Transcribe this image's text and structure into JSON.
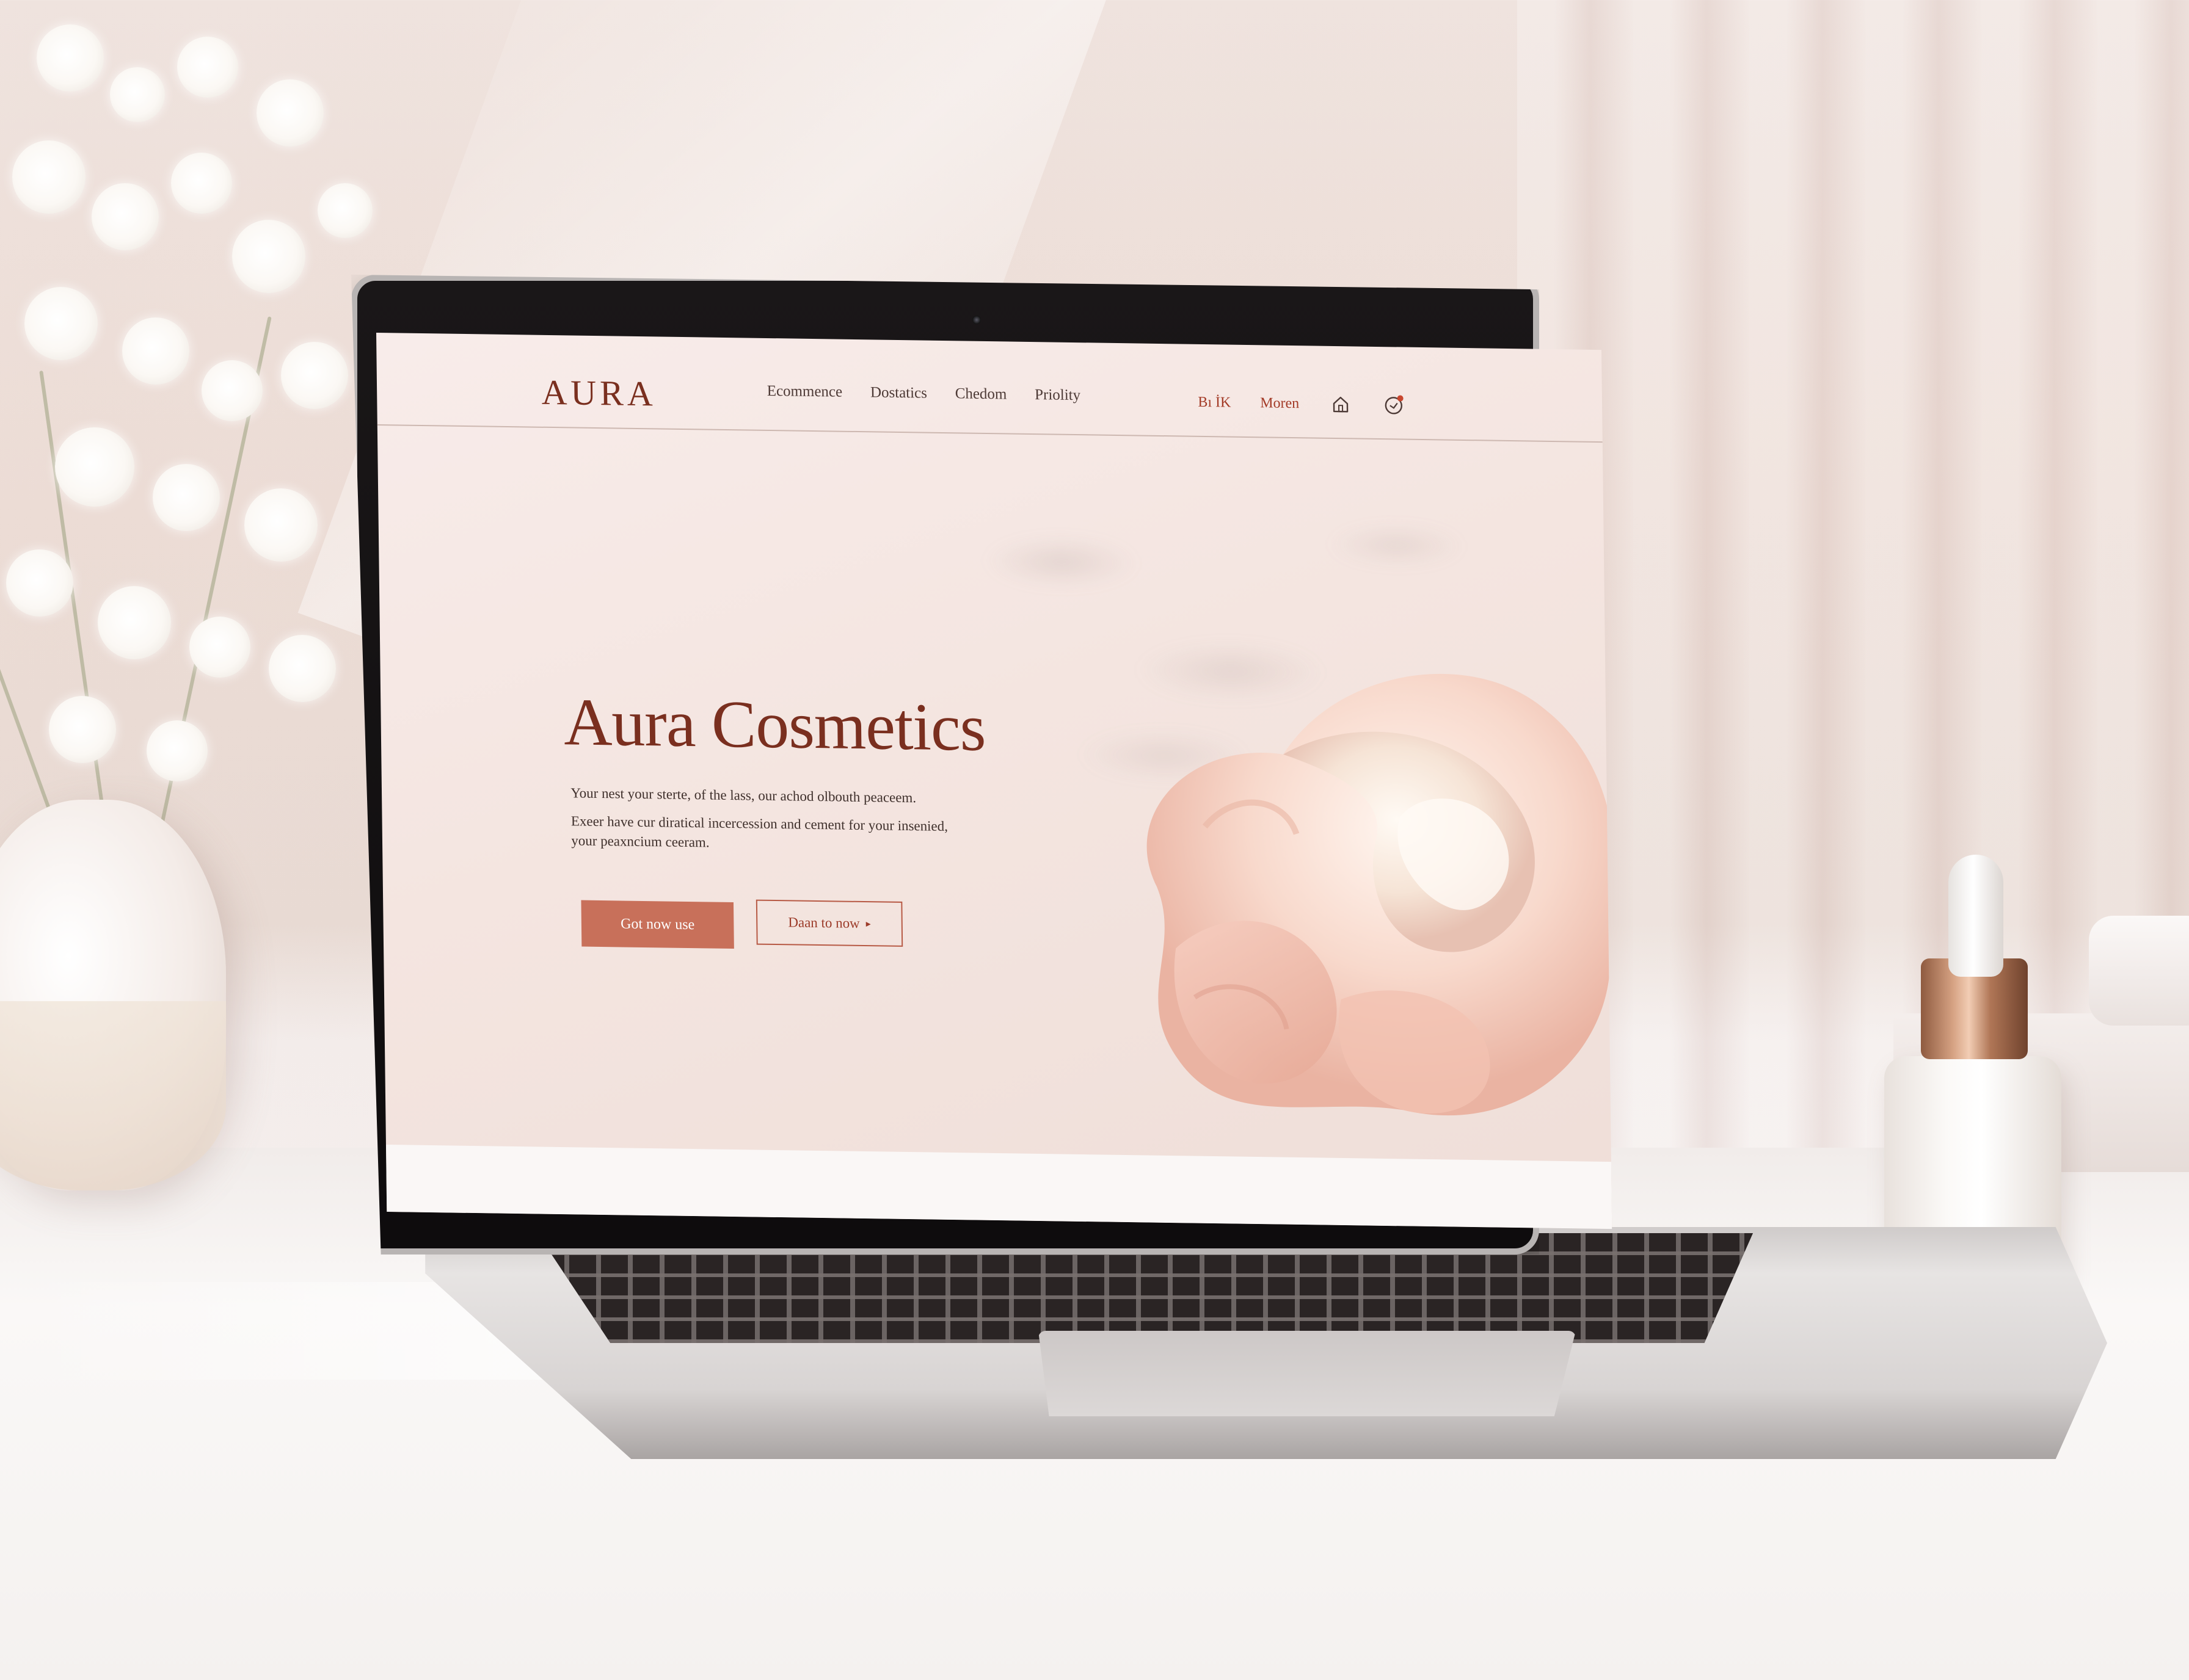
{
  "site": {
    "logo": "AURA",
    "nav": [
      "Ecommence",
      "Dostatics",
      "Chedom",
      "Priolity"
    ],
    "actions": {
      "link_1": "Bı İK",
      "link_2": "Moren",
      "icons": [
        "home-icon",
        "cart-icon"
      ]
    },
    "hero": {
      "title": "Aura Cosmetics",
      "line_1": "Your nest your sterte, of the lass, our achod olbouth peaceem.",
      "line_2": "Exeer have cur diratical incercession and cement for your insenied,",
      "line_3": "your peaxncium ceeram.",
      "primary_button": "Got now use",
      "secondary_button": "Daan to now",
      "secondary_arrow": "▸"
    }
  },
  "colors": {
    "brand": "#7a2f1f",
    "accent": "#c8705a",
    "background": "#f6e9e5"
  }
}
